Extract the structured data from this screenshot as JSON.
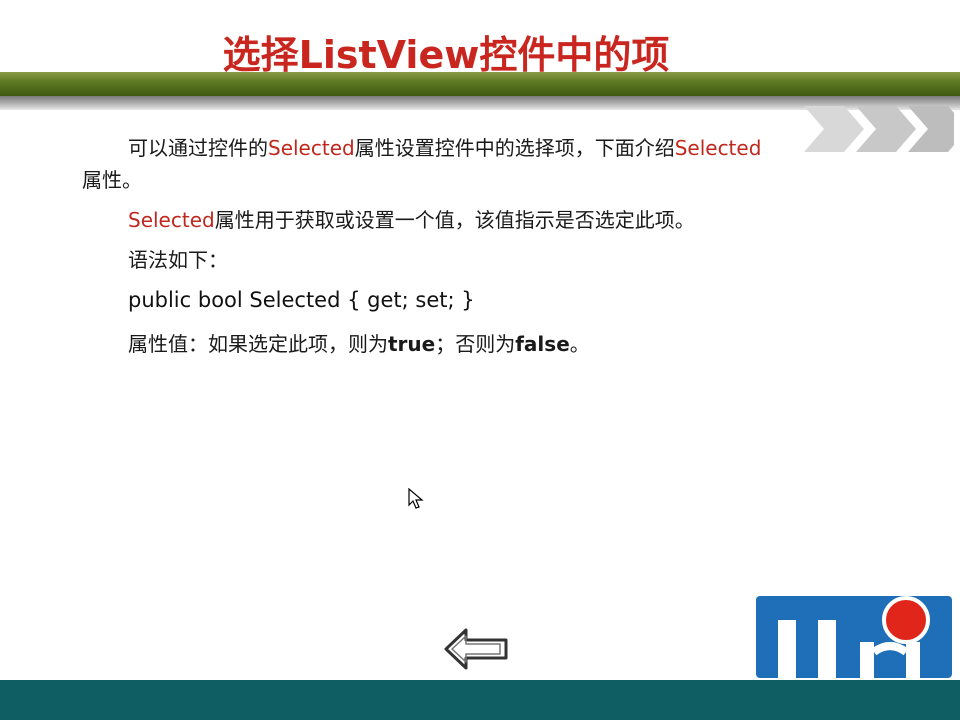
{
  "slide": {
    "title": "选择ListView控件中的项",
    "paragraphs": {
      "p1_a": "可以通过控件的",
      "p1_b": "Selected",
      "p1_c": "属性设置控件中的选择项，下面介绍",
      "p1_d": "Selected",
      "p1_e": "属性。",
      "p2_a": "Selected",
      "p2_b": "属性用于获取或设置一个值，该值指示是否选定此项。",
      "syntax_label": "语法如下：",
      "code": "public bool Selected { get; set; }",
      "p4_a": "属性值：如果选定此项，则为",
      "p4_b": "true",
      "p4_c": "；否则为",
      "p4_d": "false",
      "p4_e": "。"
    }
  },
  "icons": {
    "nav_chevrons": "double-chevron-right-icon",
    "back_button": "left-arrow-outline-icon",
    "cursor": "mouse-pointer-icon",
    "logo": "brand-logo-mr"
  },
  "colors": {
    "title": "#c8261e",
    "keyword_red": "#c0281e",
    "green_band": "#5e7a24",
    "footer": "#0f5e63",
    "logo_blue": "#1e6fb8",
    "logo_red_dot": "#e0261b"
  }
}
